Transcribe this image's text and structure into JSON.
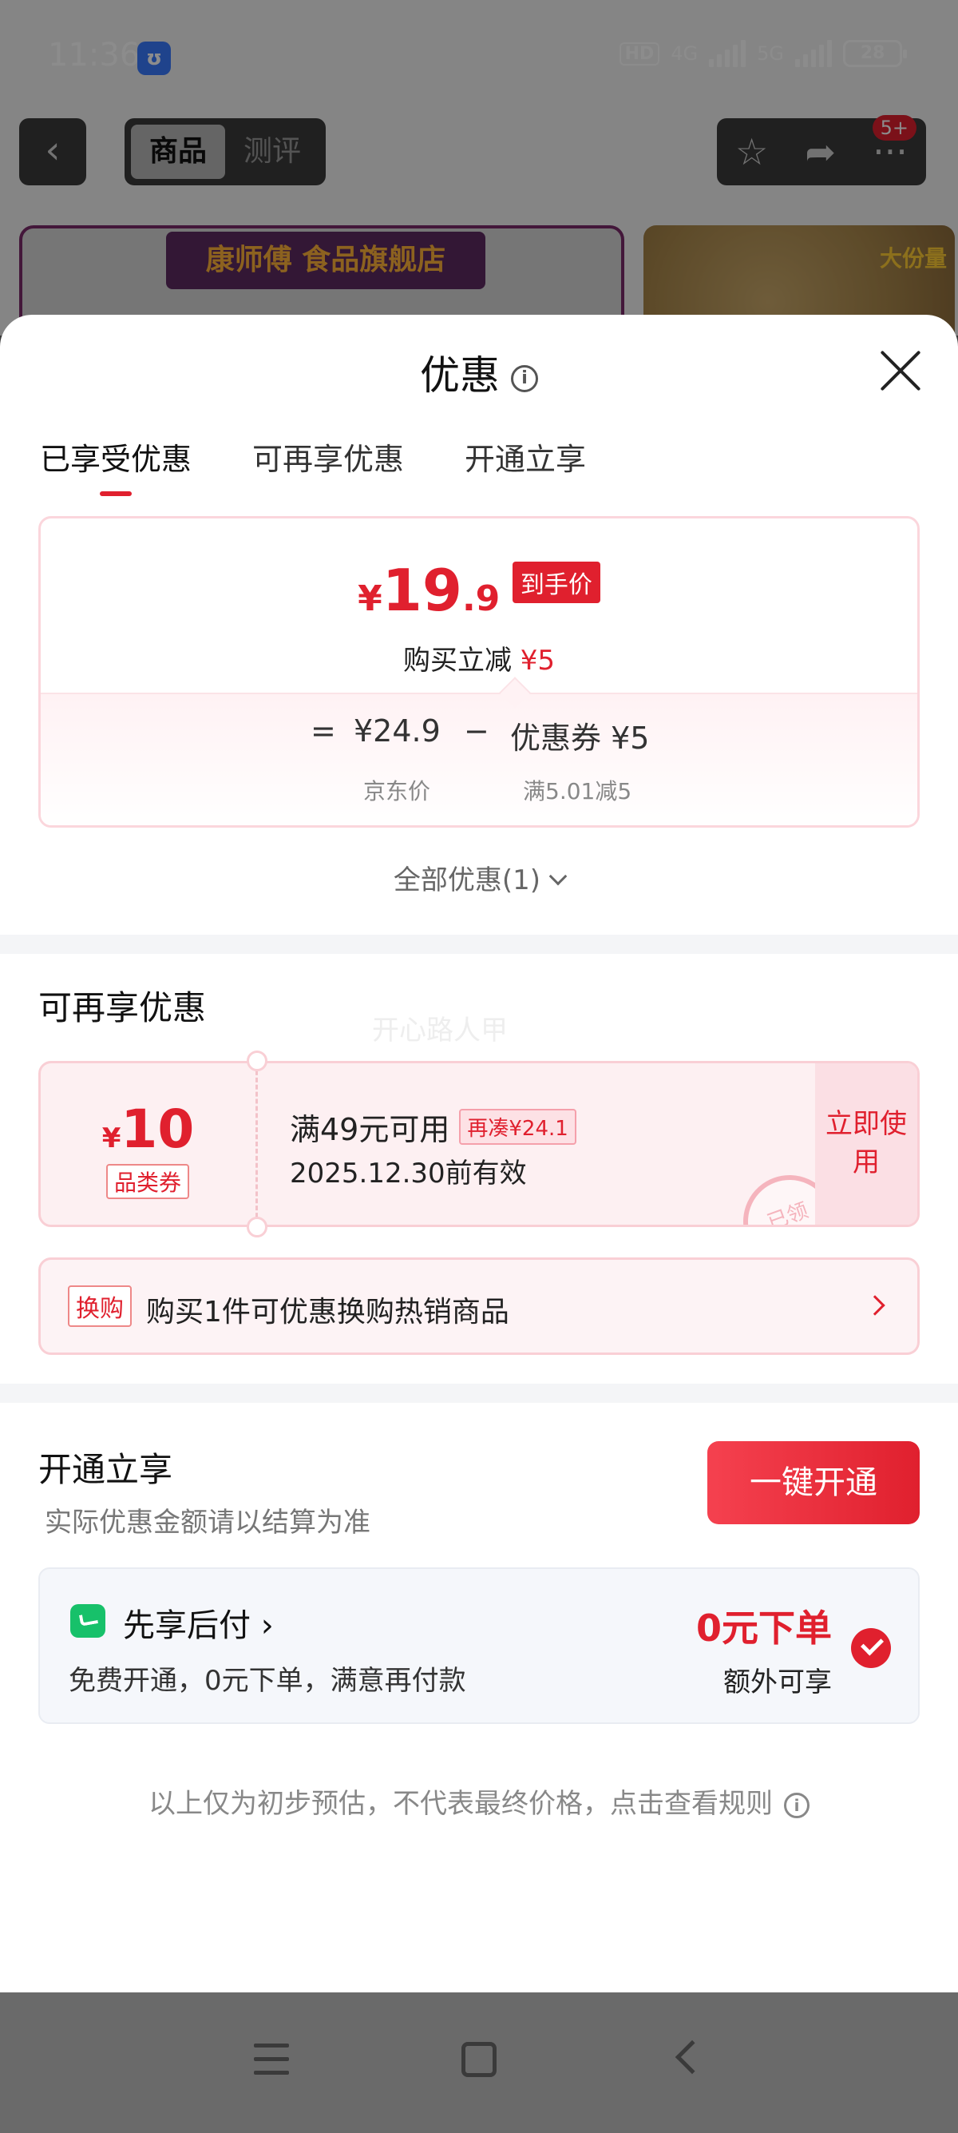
{
  "status_bar": {
    "time": "11:36",
    "app_icon": "ʊ",
    "network": "4G",
    "network2": "5G",
    "hd": "HD",
    "battery": "28"
  },
  "top_nav": {
    "tabs": [
      "商品",
      "测评"
    ],
    "badge": "5+"
  },
  "shop": {
    "banner": "康师傅 食品旗舰店",
    "tag": "大份量"
  },
  "sheet": {
    "title": "优惠",
    "tabs": [
      "已享受优惠",
      "可再享优惠",
      "开通立享"
    ],
    "price": {
      "currency": "¥",
      "integer": "19",
      "decimal": ".9",
      "tag": "到手价",
      "subtitle_prefix": "购买立减",
      "subtitle_amount": "¥5",
      "formula": {
        "eq": "=",
        "price": "¥24.9",
        "minus": "−",
        "coupon": "优惠券 ¥5"
      },
      "label_price": "京东价",
      "label_coupon": "满5.01减5"
    },
    "all_discounts": "全部优惠(1)",
    "more_section": {
      "title": "可再享优惠",
      "watermark": "开心路人甲",
      "coupon": {
        "currency": "¥",
        "amount": "10",
        "type": "品类券",
        "condition": "满49元可用",
        "extra": "再凑¥24.1",
        "valid": "2025.12.30前有效",
        "use": "立即使用",
        "stamp": "已领"
      },
      "swap": {
        "tag": "换购",
        "text": "购买1件可优惠换购热销商品"
      }
    },
    "open_section": {
      "title": "开通立享",
      "subtitle": "实际优惠金额请以结算为准",
      "button": "一键开通",
      "pay": {
        "name": "先享后付 ›",
        "desc": "免费开通，0元下单，满意再付款",
        "highlight": "0元下单",
        "extra": "额外可享"
      }
    },
    "disclaimer": "以上仅为初步预估，不代表最终价格，点击查看规则"
  }
}
